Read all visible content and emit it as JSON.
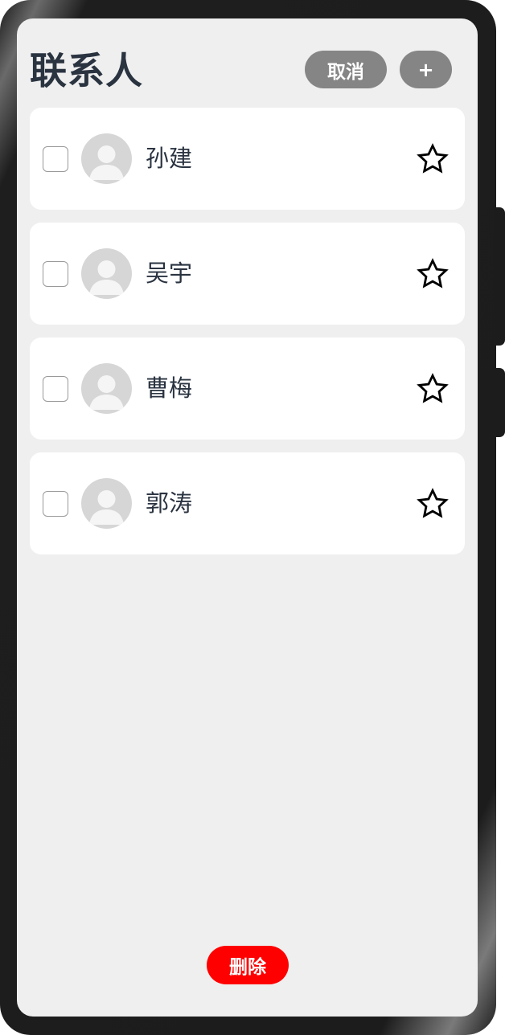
{
  "header": {
    "title": "联系人",
    "cancel_label": "取消",
    "add_label": "+"
  },
  "contacts": [
    {
      "name": "孙建",
      "checked": false,
      "favorite": false
    },
    {
      "name": "吴宇",
      "checked": false,
      "favorite": false
    },
    {
      "name": "曹梅",
      "checked": false,
      "favorite": false
    },
    {
      "name": "郭涛",
      "checked": false,
      "favorite": false
    }
  ],
  "footer": {
    "delete_label": "删除"
  },
  "icons": {
    "avatar": "person-avatar-icon",
    "favorite": "star-outline-icon"
  },
  "colors": {
    "screen_bg": "#efefef",
    "pill_button": "#858585",
    "delete_button": "#ff0000",
    "title_text": "#2a3340"
  }
}
